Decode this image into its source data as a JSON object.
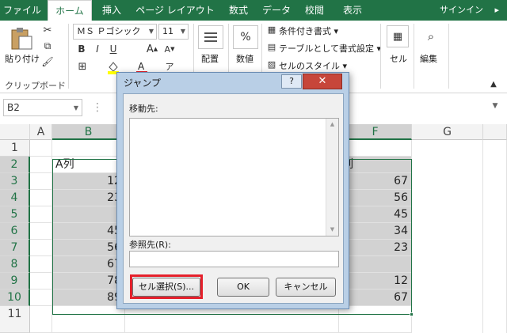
{
  "tabs": [
    "ファイル",
    "ホーム",
    "挿入",
    "ページ レイアウト",
    "数式",
    "データ",
    "校閲",
    "表示"
  ],
  "signin": "サインイン",
  "ribbon": {
    "paste_label": "貼り付け",
    "clipboard_group": "クリップボード",
    "font_name": "ＭＳ Ｐゴシック",
    "font_size": "11",
    "align_label": "配置",
    "number_label": "数値",
    "percent_symbol": "%",
    "cond_format": "条件付き書式",
    "table_format": "テーブルとして書式設定",
    "cell_style": "セルのスタイル",
    "cell_label": "セル",
    "edit_label": "編集"
  },
  "namebox": "B2",
  "columns": [
    "A",
    "B",
    "F",
    "G"
  ],
  "rows": [
    "1",
    "2",
    "3",
    "4",
    "5",
    "6",
    "7",
    "8",
    "9",
    "10",
    "11"
  ],
  "cells": {
    "b2": "A列",
    "f2": "列",
    "b3": "12",
    "b4": "23",
    "b6": "45",
    "b7": "56",
    "b8": "67",
    "b9": "78",
    "b10": "89",
    "f3": "67",
    "f4": "56",
    "f5": "45",
    "f6": "34",
    "f7": "23",
    "f9": "12",
    "f10": "67"
  },
  "dialog": {
    "title": "ジャンプ",
    "help": "?",
    "close": "✕",
    "goto_label": "移動先:",
    "ref_label": "参照先(R):",
    "special_button": "セル選択(S)...",
    "ok_button": "OK",
    "cancel_button": "キャンセル"
  }
}
